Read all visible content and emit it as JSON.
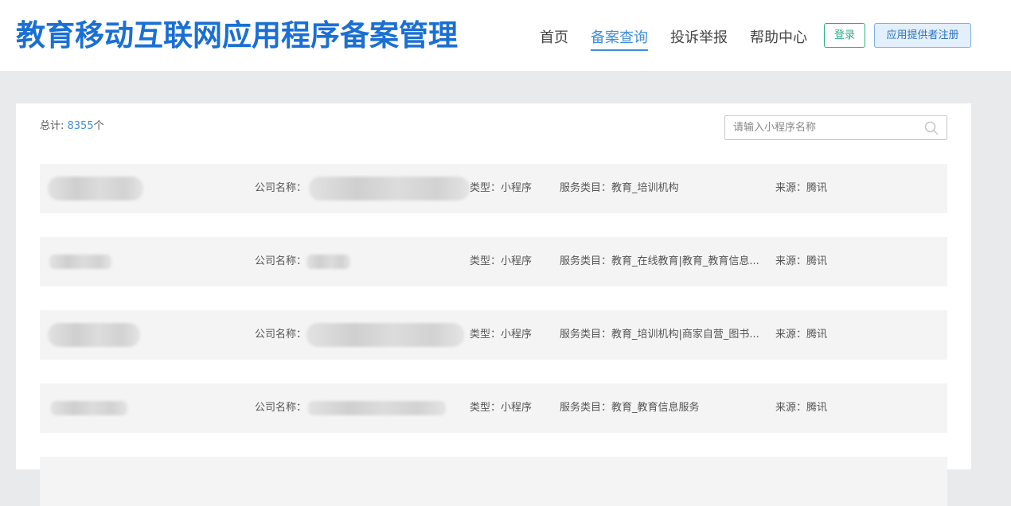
{
  "header": {
    "site_title": "教育移动互联网应用程序备案管理",
    "nav": [
      {
        "label": "首页"
      },
      {
        "label": "备案查询",
        "active": true
      },
      {
        "label": "投诉举报"
      },
      {
        "label": "帮助中心"
      }
    ],
    "login_label": "登录",
    "register_label": "应用提供者注册"
  },
  "main": {
    "total_prefix": "总计: ",
    "total_count": "8355",
    "total_suffix": "个",
    "search": {
      "placeholder": "请输入小程序名称",
      "icon": "search-icon"
    },
    "rows": [
      {
        "company_label": "公司名称：",
        "type_text": "类型：小程序",
        "service_text": "服务类目：教育_培训机构",
        "source_text": "来源：腾讯"
      },
      {
        "company_label": "公司名称：",
        "type_text": "类型：小程序",
        "service_text": "服务类目：教育_在线教育|教育_教育信息...",
        "source_text": "来源：腾讯"
      },
      {
        "company_label": "公司名称：",
        "type_text": "类型：小程序",
        "service_text": "服务类目：教育_培训机构|商家自营_图书...",
        "source_text": "来源：腾讯"
      },
      {
        "company_label": "公司名称：",
        "type_text": "类型：小程序",
        "service_text": "服务类目：教育_教育信息服务",
        "source_text": "来源：腾讯"
      }
    ]
  },
  "colors": {
    "brand_blue": "#1a6fd4",
    "nav_active": "#3f8ddb",
    "login_green": "#2bae7e",
    "row_bg": "#f4f4f4"
  }
}
